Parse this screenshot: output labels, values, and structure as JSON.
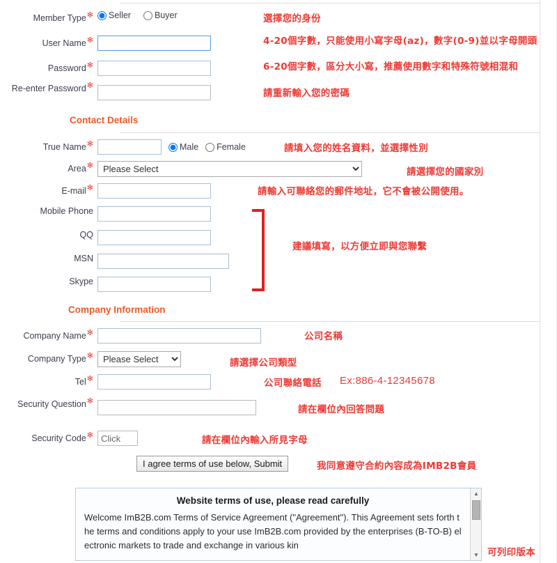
{
  "form": {
    "member_type": {
      "label": "Member Type",
      "required": true,
      "options": [
        "Seller",
        "Buyer"
      ],
      "selected": "Seller",
      "note": "選擇您的身份"
    },
    "user_name": {
      "label": "User Name",
      "required": true,
      "value": "",
      "note": "4-20個字數，只能使用小寫字母(az)，數字(0-9)並以字母開頭"
    },
    "password": {
      "label": "Password",
      "required": true,
      "value": "",
      "note": "6-20個字數，區分大小寫，推薦使用數字和特殊符號相混和"
    },
    "re_password": {
      "label": "Re-enter Password",
      "required": true,
      "value": "",
      "note": "請重新輸入您的密碼"
    },
    "contact_section": {
      "title": "Contact Details"
    },
    "true_name": {
      "label": "True Name",
      "required": true,
      "value": "",
      "gender_options": [
        "Male",
        "Female"
      ],
      "gender_selected": "Male",
      "note": "請填入您的姓名資料，並選擇性別"
    },
    "area": {
      "label": "Area",
      "required": true,
      "selected": "Please Select",
      "note": "請選擇您的國家別"
    },
    "email": {
      "label": "E-mail",
      "required": true,
      "value": "",
      "note": "請輸入可聯絡您的郵件地址，它不會被公開使用。"
    },
    "mobile_phone": {
      "label": "Mobile Phone",
      "required": false,
      "value": ""
    },
    "qq": {
      "label": "QQ",
      "required": false,
      "value": ""
    },
    "msn": {
      "label": "MSN",
      "required": false,
      "value": ""
    },
    "skype": {
      "label": "Skype",
      "required": false,
      "value": ""
    },
    "contact_group_note": "建議填寫，以方便立即與您聯繫",
    "company_section": {
      "title": "Company Information"
    },
    "company_name": {
      "label": "Company Name",
      "required": true,
      "value": "",
      "note": "公司名稱"
    },
    "company_type": {
      "label": "Company Type",
      "required": true,
      "selected": "Please Select",
      "note": "請選擇公司類型"
    },
    "tel": {
      "label": "Tel",
      "required": true,
      "value": "",
      "note": "公司聯絡電話",
      "note_example": "Ex:886-4-12345678"
    },
    "security_question": {
      "label": "Security Question",
      "required": true,
      "value": "",
      "note": "請在欄位內回答問題"
    },
    "security_code": {
      "label": "Security Code",
      "required": true,
      "value": "Click",
      "note": "請在欄位內輸入所見字母"
    },
    "submit": {
      "label": "I agree terms of use below, Submit",
      "note": "我同意遵守合約內容成為IMB2B會員"
    }
  },
  "terms": {
    "title": "Website terms of use, please read carefully",
    "body": "Welcome ImB2B.com Terms of Service Agreement (\"Agreement\"). This Agreement sets forth the terms and conditions apply to your use ImB2B.com provided by the enterprises (B-TO-B) electronic markets to trade and exchange in various kin",
    "print_note": "可列印版本"
  },
  "colors": {
    "required_asterisk": "#e8443a",
    "section_heading": "#ef5a28",
    "annotation_red": "#ee3a35",
    "bracket_red": "#e02020",
    "input_border": "#a8bfd4",
    "input_border_focus": "#5b9bd5"
  }
}
